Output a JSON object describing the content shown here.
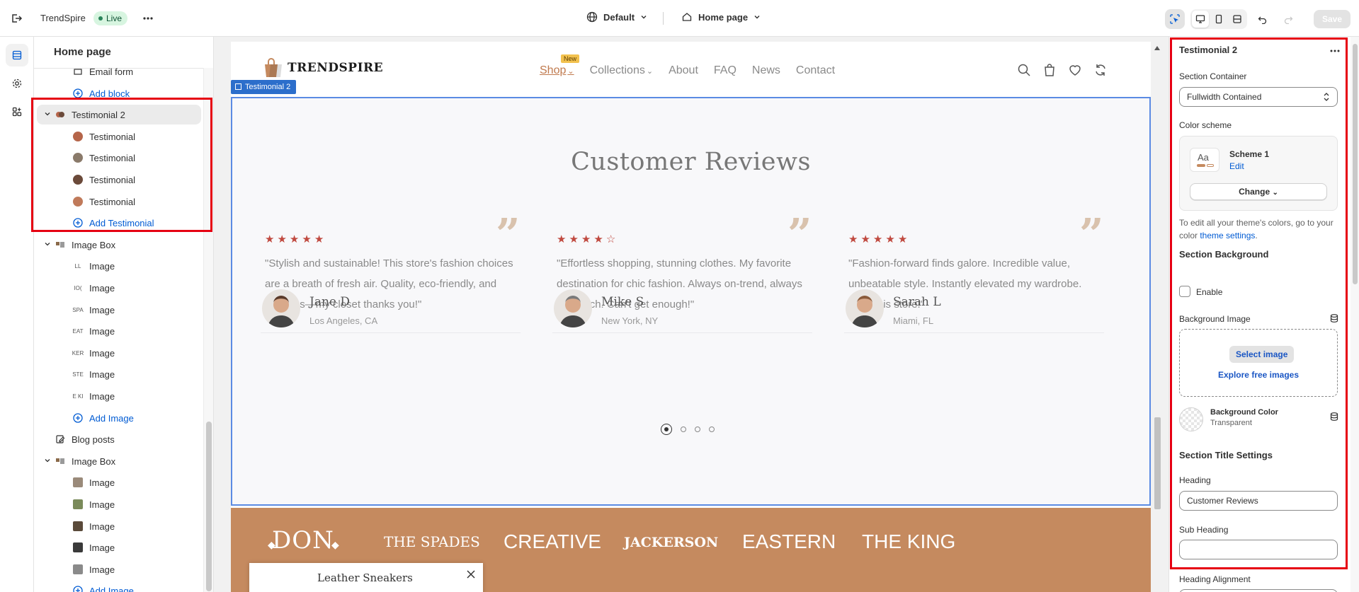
{
  "topbar": {
    "store_name": "TrendSpire",
    "status_badge": "Live",
    "theme_label": "Default",
    "page_label": "Home page",
    "save_label": "Save"
  },
  "sidebar": {
    "title": "Home page",
    "rows": [
      {
        "label": "Email form",
        "level": 2,
        "type": "text"
      },
      {
        "label": "Add block",
        "level": 2,
        "type": "add"
      },
      {
        "label": "Testimonial 2",
        "level": 1,
        "type": "section",
        "selected": true
      },
      {
        "label": "Testimonial",
        "level": 2,
        "type": "avatar"
      },
      {
        "label": "Testimonial",
        "level": 2,
        "type": "avatar"
      },
      {
        "label": "Testimonial",
        "level": 2,
        "type": "avatar"
      },
      {
        "label": "Testimonial",
        "level": 2,
        "type": "avatar"
      },
      {
        "label": "Add Testimonial",
        "level": 2,
        "type": "add"
      },
      {
        "label": "Image Box",
        "level": 1,
        "type": "section"
      },
      {
        "label": "Image",
        "level": 2,
        "type": "logo",
        "thumb": "LL"
      },
      {
        "label": "Image",
        "level": 2,
        "type": "logo",
        "thumb": "IO("
      },
      {
        "label": "Image",
        "level": 2,
        "type": "logo",
        "thumb": "SPA"
      },
      {
        "label": "Image",
        "level": 2,
        "type": "logo",
        "thumb": "EAT"
      },
      {
        "label": "Image",
        "level": 2,
        "type": "logo",
        "thumb": "KER"
      },
      {
        "label": "Image",
        "level": 2,
        "type": "logo",
        "thumb": "STE"
      },
      {
        "label": "Image",
        "level": 2,
        "type": "logo",
        "thumb": "E KI"
      },
      {
        "label": "Add Image",
        "level": 2,
        "type": "add"
      },
      {
        "label": "Blog posts",
        "level": 1,
        "type": "blog"
      },
      {
        "label": "Image Box",
        "level": 1,
        "type": "section"
      },
      {
        "label": "Image",
        "level": 2,
        "type": "photo"
      },
      {
        "label": "Image",
        "level": 2,
        "type": "photo"
      },
      {
        "label": "Image",
        "level": 2,
        "type": "photo"
      },
      {
        "label": "Image",
        "level": 2,
        "type": "photo"
      },
      {
        "label": "Image",
        "level": 2,
        "type": "photo"
      },
      {
        "label": "Add Image",
        "level": 2,
        "type": "add"
      }
    ]
  },
  "preview": {
    "logo_text": "TRENDSPIRE",
    "nav": [
      {
        "label": "Shop",
        "active": true,
        "badge": "New",
        "dropdown": true
      },
      {
        "label": "Collections",
        "dropdown": true
      },
      {
        "label": "About"
      },
      {
        "label": "FAQ"
      },
      {
        "label": "News"
      },
      {
        "label": "Contact"
      }
    ],
    "section_tag": "Testimonial 2",
    "heading": "Customer Reviews",
    "testimonials": [
      {
        "rating": 5,
        "text": "\"Stylish and sustainable! This store's fashion choices are a breath of fresh air. Quality, eco-friendly, and fabulous—my closet thanks you!\"",
        "name": "Jane D",
        "location": "Los Angeles, CA"
      },
      {
        "rating": 4,
        "text": "\"Effortless shopping, stunning clothes. My favorite destination for chic fashion. Always on-trend, always top-notch. Can't get enough!\"",
        "name": "Mike S",
        "location": "New York, NY"
      },
      {
        "rating": 5,
        "text": "\"Fashion-forward finds galore. Incredible value, unbeatable style. Instantly elevated my wardrobe. Love this store!\"",
        "name": "Sarah L",
        "location": "Miami, FL"
      }
    ],
    "brands": [
      "DON",
      "THE SPADES",
      "CREATIVE",
      "JACKERSON",
      "EASTERN",
      "THE KING"
    ],
    "popup_product": "Leather Sneakers",
    "brand_color": "#c58a5f",
    "accent_color": "#2c6ecb"
  },
  "settings": {
    "title": "Testimonial 2",
    "section_container_label": "Section Container",
    "section_container_value": "Fullwidth Contained",
    "color_scheme_label": "Color scheme",
    "scheme_name": "Scheme 1",
    "scheme_edit": "Edit",
    "scheme_preview": "Aa",
    "change_label": "Change",
    "help_text_prefix": "To edit all your theme's colors, go to your color ",
    "help_link": "theme settings",
    "help_text_suffix": ".",
    "section_background_heading": "Section Background",
    "enable_label": "Enable",
    "background_image_label": "Background Image",
    "select_image_label": "Select image",
    "explore_label": "Explore free images",
    "background_color_label": "Background Color",
    "background_color_value": "Transparent",
    "section_title_heading": "Section Title Settings",
    "heading_label": "Heading",
    "heading_value": "Customer Reviews",
    "subheading_label": "Sub Heading",
    "subheading_value": "",
    "heading_alignment_label": "Heading Alignment"
  }
}
